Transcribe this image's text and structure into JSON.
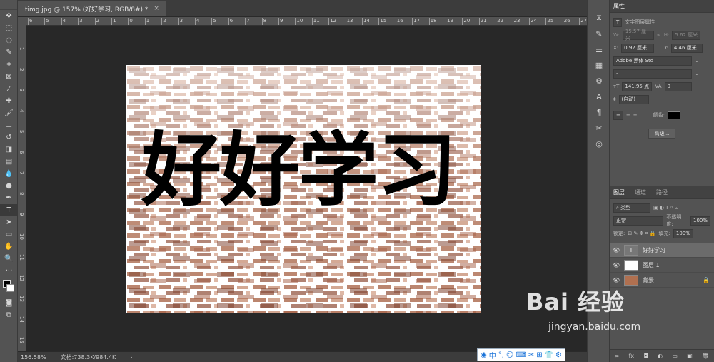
{
  "document": {
    "tab_title": "timg.jpg @ 157% (好好学习, RGB/8#) *",
    "tab_close": "×",
    "canvas_text": "好好学习",
    "ruler_marks": [
      "6",
      "5",
      "4",
      "3",
      "2",
      "1",
      "0",
      "1",
      "2",
      "3",
      "4",
      "5",
      "6",
      "7",
      "8",
      "9",
      "10",
      "11",
      "12",
      "13",
      "14",
      "15",
      "16",
      "17",
      "18",
      "19",
      "20",
      "21",
      "22",
      "23",
      "24",
      "25",
      "26",
      "27"
    ],
    "vruler_marks": [
      "1",
      "2",
      "3",
      "4",
      "5",
      "6",
      "7",
      "8",
      "9",
      "10",
      "11",
      "12",
      "13",
      "14",
      "15"
    ]
  },
  "status": {
    "zoom": "156.58%",
    "doc_size": "文档:738.3K/984.4K",
    "arrow": "›"
  },
  "ime_bar": {
    "items": [
      "中",
      "°,",
      "☺",
      "⌨",
      "✂",
      "⊞",
      "👕",
      "⚙"
    ]
  },
  "properties": {
    "title": "属性",
    "layer_type": "文字图层属性",
    "w_label": "W:",
    "w_value": "15.57 厘米",
    "h_label": "H:",
    "h_value": "5.62 厘米",
    "x_label": "X:",
    "x_value": "0.92 厘米",
    "y_label": "Y:",
    "y_value": "4.46 厘米",
    "font_family": "Adobe 黑体 Std",
    "font_style": "-",
    "font_size": "141.95 点",
    "tracking": "0",
    "leading": "(自动)",
    "color_label": "颜色:",
    "advanced_button": "高级..."
  },
  "layers": {
    "tabs": [
      "图层",
      "通道",
      "路径"
    ],
    "filter_kind": "类型",
    "blend_mode": "正常",
    "opacity_label": "不透明度:",
    "opacity_value": "100%",
    "lock_label": "锁定:",
    "fill_label": "填充:",
    "fill_value": "100%",
    "items": [
      {
        "name": "好好学习",
        "thumb": "T"
      },
      {
        "name": "图层 1",
        "thumb": ""
      },
      {
        "name": "背景",
        "thumb": ""
      }
    ],
    "footer_icons": [
      "∞",
      "fx",
      "◘",
      "◐",
      "▭",
      "▣",
      "🗑"
    ]
  },
  "watermark": {
    "brand": "Bai 经验",
    "url": "jingyan.baidu.com"
  },
  "colors": {
    "panel_bg": "#535353",
    "canvas_bg": "#282828",
    "text_color": "#000000"
  }
}
